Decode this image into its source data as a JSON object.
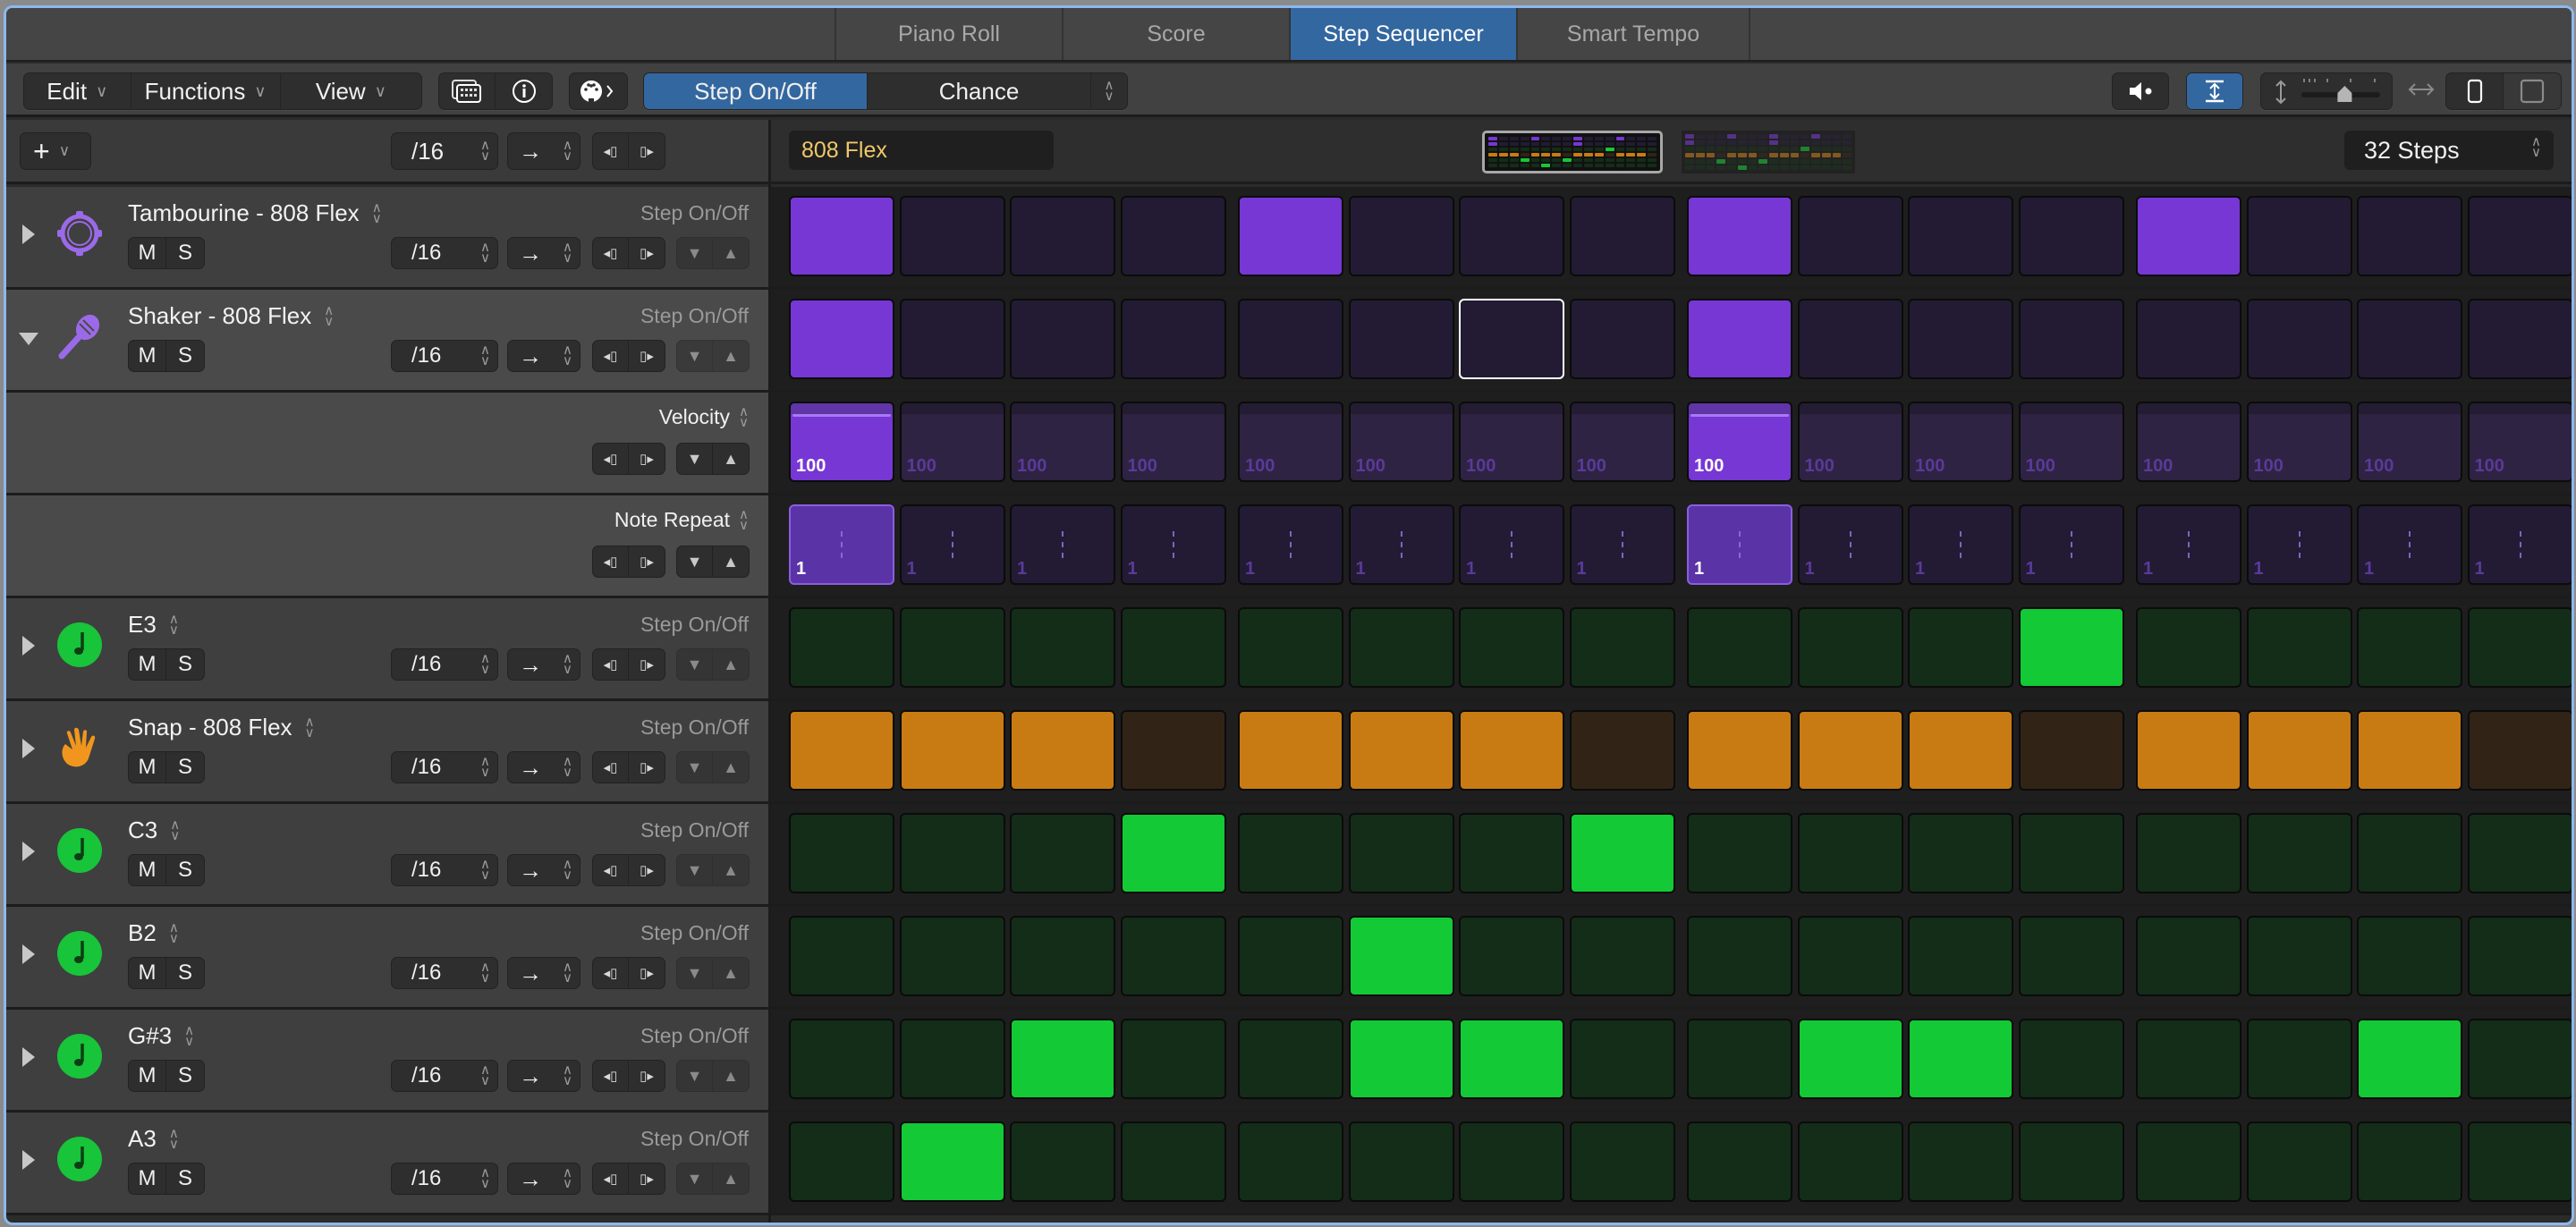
{
  "tabs": [
    {
      "label": "Piano Roll",
      "active": false
    },
    {
      "label": "Score",
      "active": false
    },
    {
      "label": "Step Sequencer",
      "active": true
    },
    {
      "label": "Smart Tempo",
      "active": false
    }
  ],
  "toolbar": {
    "menus": [
      {
        "label": "Edit",
        "icon": "chevron-down-icon"
      },
      {
        "label": "Functions",
        "icon": "chevron-down-icon"
      },
      {
        "label": "View",
        "icon": "chevron-down-icon"
      }
    ],
    "edit_modes": {
      "selected": "Step On/Off",
      "other": "Chance"
    },
    "icons": [
      "keyboard-icon",
      "info-icon",
      "midi-out-icon",
      "speaker-icon",
      "fit-height-icon",
      "row-height-slider",
      "fit-width-icon",
      "narrow-view-icon",
      "wide-view-icon"
    ],
    "row_height_slider_value": 0.55
  },
  "header": {
    "add_label": "+",
    "rate": "/16",
    "direction": "→",
    "pattern_name": "808 Flex",
    "steps": "32 Steps",
    "mini_patterns": 2,
    "selected_pattern_page": 1
  },
  "lane_controls": {
    "mute": "M",
    "solo": "S",
    "rate": "/16",
    "direction": "→",
    "mode_label": "Step On/Off"
  },
  "colors": {
    "purple_on": "#7637d4",
    "purple_off": "#221b33",
    "green_on": "#13c935",
    "green_off": "#132d18",
    "orange_on": "#c97b13",
    "orange_off": "#312416",
    "accent_blue": "#3367a0",
    "pattern_name_text": "#f0c86a"
  },
  "lanes": [
    {
      "name": "Tambourine - 808 Flex",
      "icon": "tambourine-icon",
      "color": "purple",
      "expanded": false,
      "steps": [
        1,
        0,
        0,
        0,
        1,
        0,
        0,
        0,
        1,
        0,
        0,
        0,
        1,
        0,
        0,
        0
      ]
    },
    {
      "name": "Shaker - 808 Flex",
      "icon": "maraca-icon",
      "color": "purple",
      "expanded": true,
      "steps": [
        1,
        0,
        0,
        0,
        0,
        0,
        0,
        0,
        1,
        0,
        0,
        0,
        0,
        0,
        0,
        0
      ],
      "selected_step": 6
    },
    {
      "sub": true,
      "parent": "Shaker - 808 Flex",
      "label": "Velocity",
      "kind": "velocity",
      "values": [
        100,
        100,
        100,
        100,
        100,
        100,
        100,
        100,
        100,
        100,
        100,
        100,
        100,
        100,
        100,
        100
      ],
      "active": [
        1,
        0,
        0,
        0,
        0,
        0,
        0,
        0,
        1,
        0,
        0,
        0,
        0,
        0,
        0,
        0
      ]
    },
    {
      "sub": true,
      "parent": "Shaker - 808 Flex",
      "label": "Note Repeat",
      "kind": "repeat",
      "values": [
        1,
        1,
        1,
        1,
        1,
        1,
        1,
        1,
        1,
        1,
        1,
        1,
        1,
        1,
        1,
        1
      ],
      "active": [
        1,
        0,
        0,
        0,
        0,
        0,
        0,
        0,
        1,
        0,
        0,
        0,
        0,
        0,
        0,
        0
      ]
    },
    {
      "name": "E3",
      "icon": "note-icon",
      "color": "green",
      "expanded": false,
      "steps": [
        0,
        0,
        0,
        0,
        0,
        0,
        0,
        0,
        0,
        0,
        0,
        1,
        0,
        0,
        0,
        0
      ]
    },
    {
      "name": "Snap - 808 Flex",
      "icon": "hand-clap-icon",
      "color": "orange",
      "expanded": false,
      "steps": [
        1,
        1,
        1,
        0,
        1,
        1,
        1,
        0,
        1,
        1,
        1,
        0,
        1,
        1,
        1,
        0
      ]
    },
    {
      "name": "C3",
      "icon": "note-icon",
      "color": "green",
      "expanded": false,
      "steps": [
        0,
        0,
        0,
        1,
        0,
        0,
        0,
        1,
        0,
        0,
        0,
        0,
        0,
        0,
        0,
        0
      ]
    },
    {
      "name": "B2",
      "icon": "note-icon",
      "color": "green",
      "expanded": false,
      "steps": [
        0,
        0,
        0,
        0,
        0,
        1,
        0,
        0,
        0,
        0,
        0,
        0,
        0,
        0,
        0,
        0
      ]
    },
    {
      "name": "G#3",
      "icon": "note-icon",
      "color": "green",
      "expanded": false,
      "steps": [
        0,
        0,
        1,
        0,
        0,
        1,
        1,
        0,
        0,
        1,
        1,
        0,
        0,
        0,
        1,
        0
      ]
    },
    {
      "name": "A3",
      "icon": "note-icon",
      "color": "green",
      "expanded": false,
      "steps": [
        0,
        1,
        0,
        0,
        0,
        0,
        0,
        0,
        0,
        0,
        0,
        0,
        0,
        0,
        0,
        0
      ]
    }
  ]
}
